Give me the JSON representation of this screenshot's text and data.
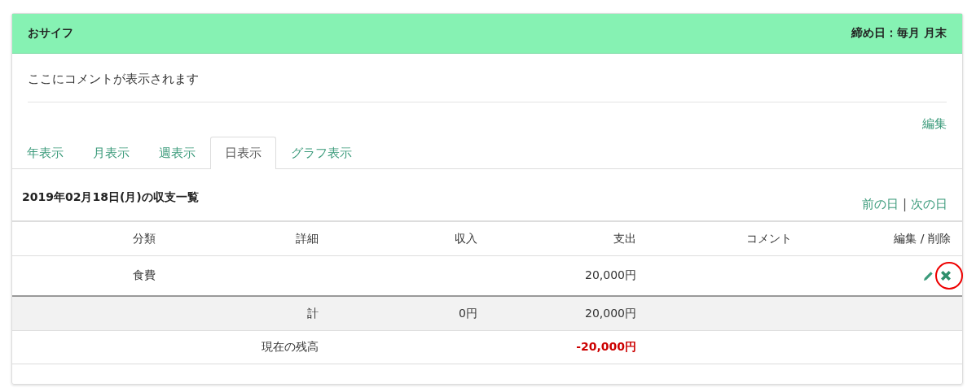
{
  "panel": {
    "title": "おサイフ",
    "closing_day": "締め日：毎月 月末",
    "comment": "ここにコメントが表示されます",
    "edit_link": "編集"
  },
  "tabs": [
    {
      "label": "年表示",
      "selected": false
    },
    {
      "label": "月表示",
      "selected": false
    },
    {
      "label": "週表示",
      "selected": false
    },
    {
      "label": "日表示",
      "selected": true
    },
    {
      "label": "グラフ表示",
      "selected": false
    }
  ],
  "list": {
    "heading": "2019年02月18日(月)の収支一覧",
    "prev_link": "前の日",
    "separator": "|",
    "next_link": "次の日"
  },
  "table": {
    "columns": [
      "分類",
      "詳細",
      "収入",
      "支出",
      "コメント",
      "編集 / 削除"
    ],
    "rows": [
      {
        "category": "食費",
        "detail": "",
        "income": "",
        "expense": "20,000円",
        "comment": "",
        "delete_highlighted": true
      }
    ],
    "summary": [
      {
        "kind": "total",
        "label": "計",
        "income": "0円",
        "expense": "20,000円"
      },
      {
        "kind": "balance",
        "label": "現在の残高",
        "expense": "-20,000円"
      }
    ]
  }
}
